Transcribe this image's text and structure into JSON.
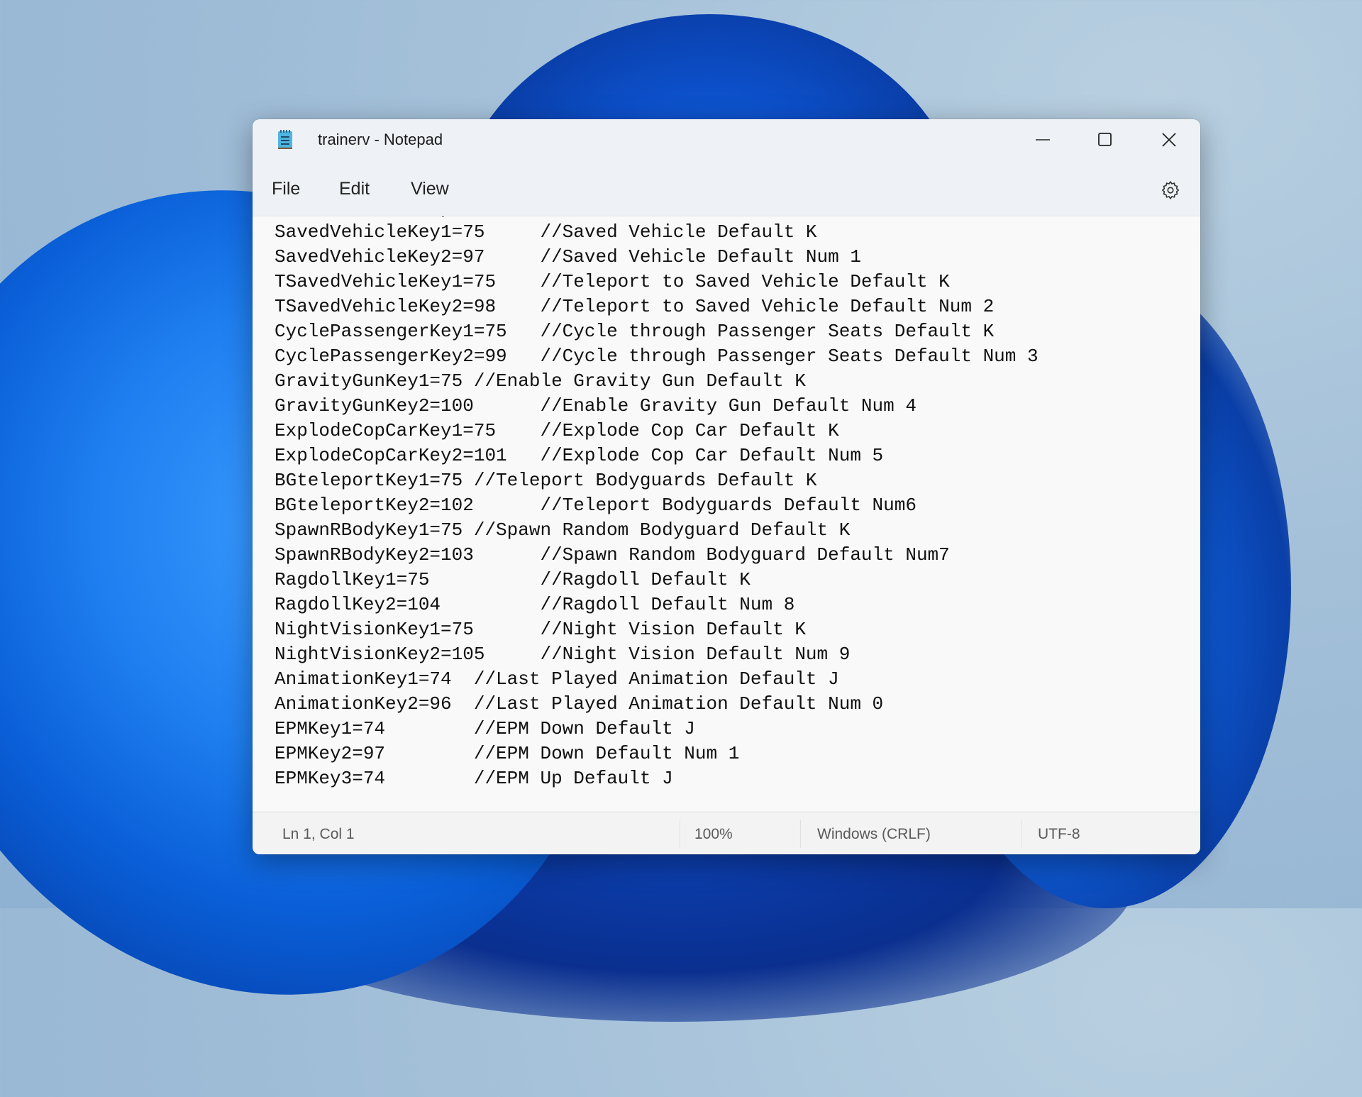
{
  "window": {
    "title": "trainerv - Notepad",
    "controls": {
      "minimize": "minimize",
      "maximize": "maximize",
      "close": "close"
    }
  },
  "menu": {
    "items": [
      "File",
      "Edit",
      "View"
    ],
    "settings_icon": "gear-icon"
  },
  "editor": {
    "lines": [
      "SavedVehicleKey1=75     //Saved Vehicle Default K",
      "SavedVehicleKey2=97     //Saved Vehicle Default Num 1",
      "TSavedVehicleKey1=75    //Teleport to Saved Vehicle Default K",
      "TSavedVehicleKey2=98    //Teleport to Saved Vehicle Default Num 2",
      "CyclePassengerKey1=75   //Cycle through Passenger Seats Default K",
      "CyclePassengerKey2=99   //Cycle through Passenger Seats Default Num 3",
      "GravityGunKey1=75 //Enable Gravity Gun Default K",
      "GravityGunKey2=100      //Enable Gravity Gun Default Num 4",
      "ExplodeCopCarKey1=75    //Explode Cop Car Default K",
      "ExplodeCopCarKey2=101   //Explode Cop Car Default Num 5",
      "BGteleportKey1=75 //Teleport Bodyguards Default K",
      "BGteleportKey2=102      //Teleport Bodyguards Default Num6",
      "SpawnRBodyKey1=75 //Spawn Random Bodyguard Default K",
      "SpawnRBodyKey2=103      //Spawn Random Bodyguard Default Num7",
      "RagdollKey1=75          //Ragdoll Default K",
      "RagdollKey2=104         //Ragdoll Default Num 8",
      "NightVisionKey1=75      //Night Vision Default K",
      "NightVisionKey2=105     //Night Vision Default Num 9",
      "AnimationKey1=74  //Last Played Animation Default J",
      "AnimationKey2=96  //Last Played Animation Default Num 0",
      "EPMKey1=74        //EPM Down Default J",
      "EPMKey2=97        //EPM Down Default Num 1",
      "EPMKey3=74        //EPM Up Default J"
    ]
  },
  "statusbar": {
    "position": "Ln 1, Col 1",
    "zoom": "100%",
    "line_ending": "Windows (CRLF)",
    "encoding": "UTF-8"
  }
}
